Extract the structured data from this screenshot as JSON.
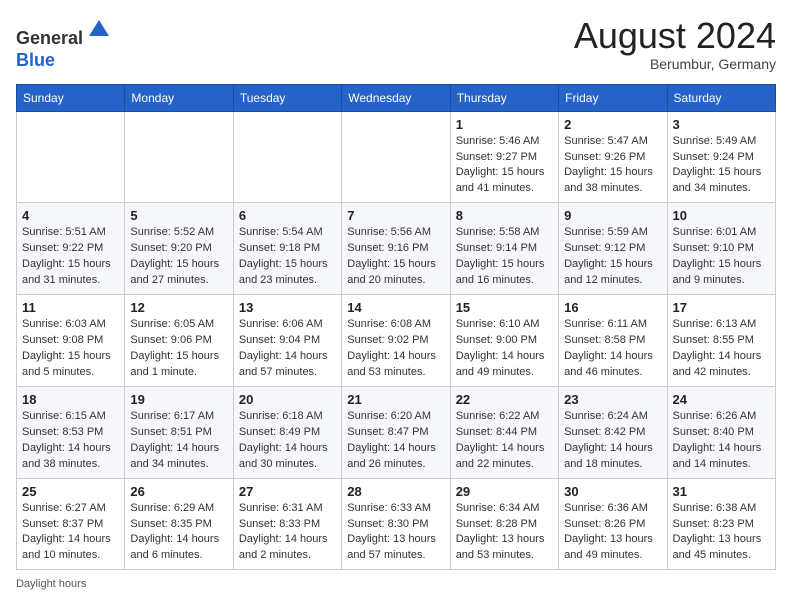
{
  "header": {
    "logo_line1": "General",
    "logo_line2": "Blue",
    "month_year": "August 2024",
    "location": "Berumbur, Germany"
  },
  "days_of_week": [
    "Sunday",
    "Monday",
    "Tuesday",
    "Wednesday",
    "Thursday",
    "Friday",
    "Saturday"
  ],
  "weeks": [
    [
      {
        "day": "",
        "info": ""
      },
      {
        "day": "",
        "info": ""
      },
      {
        "day": "",
        "info": ""
      },
      {
        "day": "",
        "info": ""
      },
      {
        "day": "1",
        "info": "Sunrise: 5:46 AM\nSunset: 9:27 PM\nDaylight: 15 hours\nand 41 minutes."
      },
      {
        "day": "2",
        "info": "Sunrise: 5:47 AM\nSunset: 9:26 PM\nDaylight: 15 hours\nand 38 minutes."
      },
      {
        "day": "3",
        "info": "Sunrise: 5:49 AM\nSunset: 9:24 PM\nDaylight: 15 hours\nand 34 minutes."
      }
    ],
    [
      {
        "day": "4",
        "info": "Sunrise: 5:51 AM\nSunset: 9:22 PM\nDaylight: 15 hours\nand 31 minutes."
      },
      {
        "day": "5",
        "info": "Sunrise: 5:52 AM\nSunset: 9:20 PM\nDaylight: 15 hours\nand 27 minutes."
      },
      {
        "day": "6",
        "info": "Sunrise: 5:54 AM\nSunset: 9:18 PM\nDaylight: 15 hours\nand 23 minutes."
      },
      {
        "day": "7",
        "info": "Sunrise: 5:56 AM\nSunset: 9:16 PM\nDaylight: 15 hours\nand 20 minutes."
      },
      {
        "day": "8",
        "info": "Sunrise: 5:58 AM\nSunset: 9:14 PM\nDaylight: 15 hours\nand 16 minutes."
      },
      {
        "day": "9",
        "info": "Sunrise: 5:59 AM\nSunset: 9:12 PM\nDaylight: 15 hours\nand 12 minutes."
      },
      {
        "day": "10",
        "info": "Sunrise: 6:01 AM\nSunset: 9:10 PM\nDaylight: 15 hours\nand 9 minutes."
      }
    ],
    [
      {
        "day": "11",
        "info": "Sunrise: 6:03 AM\nSunset: 9:08 PM\nDaylight: 15 hours\nand 5 minutes."
      },
      {
        "day": "12",
        "info": "Sunrise: 6:05 AM\nSunset: 9:06 PM\nDaylight: 15 hours\nand 1 minute."
      },
      {
        "day": "13",
        "info": "Sunrise: 6:06 AM\nSunset: 9:04 PM\nDaylight: 14 hours\nand 57 minutes."
      },
      {
        "day": "14",
        "info": "Sunrise: 6:08 AM\nSunset: 9:02 PM\nDaylight: 14 hours\nand 53 minutes."
      },
      {
        "day": "15",
        "info": "Sunrise: 6:10 AM\nSunset: 9:00 PM\nDaylight: 14 hours\nand 49 minutes."
      },
      {
        "day": "16",
        "info": "Sunrise: 6:11 AM\nSunset: 8:58 PM\nDaylight: 14 hours\nand 46 minutes."
      },
      {
        "day": "17",
        "info": "Sunrise: 6:13 AM\nSunset: 8:55 PM\nDaylight: 14 hours\nand 42 minutes."
      }
    ],
    [
      {
        "day": "18",
        "info": "Sunrise: 6:15 AM\nSunset: 8:53 PM\nDaylight: 14 hours\nand 38 minutes."
      },
      {
        "day": "19",
        "info": "Sunrise: 6:17 AM\nSunset: 8:51 PM\nDaylight: 14 hours\nand 34 minutes."
      },
      {
        "day": "20",
        "info": "Sunrise: 6:18 AM\nSunset: 8:49 PM\nDaylight: 14 hours\nand 30 minutes."
      },
      {
        "day": "21",
        "info": "Sunrise: 6:20 AM\nSunset: 8:47 PM\nDaylight: 14 hours\nand 26 minutes."
      },
      {
        "day": "22",
        "info": "Sunrise: 6:22 AM\nSunset: 8:44 PM\nDaylight: 14 hours\nand 22 minutes."
      },
      {
        "day": "23",
        "info": "Sunrise: 6:24 AM\nSunset: 8:42 PM\nDaylight: 14 hours\nand 18 minutes."
      },
      {
        "day": "24",
        "info": "Sunrise: 6:26 AM\nSunset: 8:40 PM\nDaylight: 14 hours\nand 14 minutes."
      }
    ],
    [
      {
        "day": "25",
        "info": "Sunrise: 6:27 AM\nSunset: 8:37 PM\nDaylight: 14 hours\nand 10 minutes."
      },
      {
        "day": "26",
        "info": "Sunrise: 6:29 AM\nSunset: 8:35 PM\nDaylight: 14 hours\nand 6 minutes."
      },
      {
        "day": "27",
        "info": "Sunrise: 6:31 AM\nSunset: 8:33 PM\nDaylight: 14 hours\nand 2 minutes."
      },
      {
        "day": "28",
        "info": "Sunrise: 6:33 AM\nSunset: 8:30 PM\nDaylight: 13 hours\nand 57 minutes."
      },
      {
        "day": "29",
        "info": "Sunrise: 6:34 AM\nSunset: 8:28 PM\nDaylight: 13 hours\nand 53 minutes."
      },
      {
        "day": "30",
        "info": "Sunrise: 6:36 AM\nSunset: 8:26 PM\nDaylight: 13 hours\nand 49 minutes."
      },
      {
        "day": "31",
        "info": "Sunrise: 6:38 AM\nSunset: 8:23 PM\nDaylight: 13 hours\nand 45 minutes."
      }
    ]
  ],
  "footer": {
    "daylight_label": "Daylight hours"
  }
}
